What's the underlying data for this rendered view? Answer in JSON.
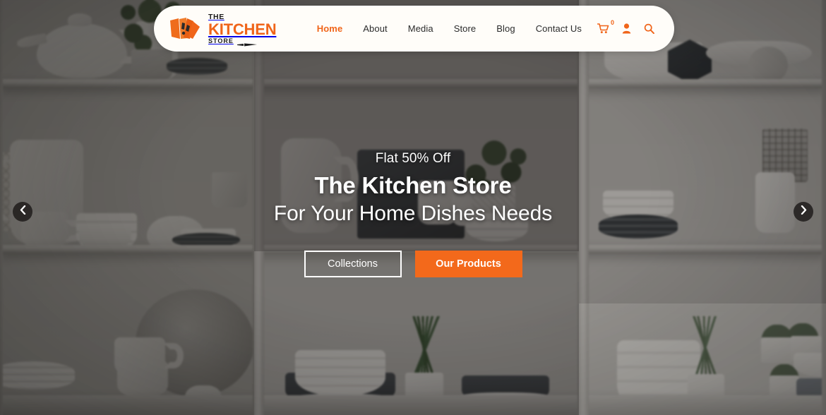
{
  "brand": {
    "logo_the": "THE",
    "logo_kitchen": "KITCHEN",
    "logo_store": "STORE",
    "logo_mark_icon": "fan-knives-icon",
    "accent_color": "#f0651a"
  },
  "header": {
    "nav": [
      {
        "label": "Home",
        "active": true
      },
      {
        "label": "About",
        "active": false
      },
      {
        "label": "Media",
        "active": false
      },
      {
        "label": "Store",
        "active": false
      },
      {
        "label": "Blog",
        "active": false
      },
      {
        "label": "Contact Us",
        "active": false
      }
    ],
    "icons": {
      "cart": "cart-icon",
      "cart_count": "0",
      "account": "user-icon",
      "search": "search-icon"
    }
  },
  "hero": {
    "kicker": "Flat 50% Off",
    "title": "The Kitchen Store",
    "subtitle": "For Your Home Dishes Needs",
    "primary_button": "Our Products",
    "secondary_button": "Collections",
    "primary_button_color": "#f3691b"
  },
  "carousel": {
    "prev_icon": "chevron-left-icon",
    "next_icon": "chevron-right-icon",
    "prev_glyph": "‹",
    "next_glyph": "›"
  }
}
